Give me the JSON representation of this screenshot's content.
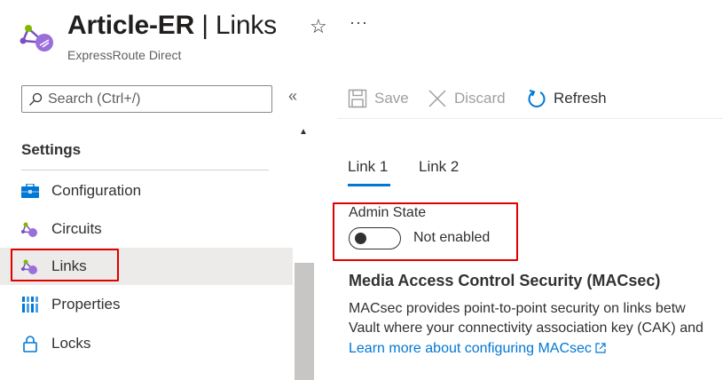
{
  "header": {
    "resource_name": "Article-ER",
    "separator": "|",
    "blade_name": "Links",
    "subtitle": "ExpressRoute Direct",
    "star_icon": "☆",
    "more_icon": "···"
  },
  "search": {
    "placeholder": "Search (Ctrl+/)",
    "value": ""
  },
  "sidebar": {
    "collapse_icon": "«",
    "section_heading": "Settings",
    "items": [
      {
        "label": "Configuration",
        "icon": "toolbox-icon"
      },
      {
        "label": "Circuits",
        "icon": "expressroute-icon"
      },
      {
        "label": "Links",
        "icon": "expressroute-icon",
        "selected": true
      },
      {
        "label": "Properties",
        "icon": "properties-icon"
      },
      {
        "label": "Locks",
        "icon": "lock-icon"
      }
    ]
  },
  "toolbar": {
    "save_label": "Save",
    "discard_label": "Discard",
    "refresh_label": "Refresh"
  },
  "tabs": [
    {
      "label": "Link 1",
      "active": true
    },
    {
      "label": "Link 2",
      "active": false
    }
  ],
  "admin_state": {
    "label": "Admin State",
    "toggle_text": "Not enabled",
    "enabled": false
  },
  "macsec": {
    "heading": "Media Access Control Security (MACsec)",
    "line1": "MACsec provides point-to-point security on links betw",
    "line2": "Vault where your connectivity association key (CAK) and",
    "link_text": "Learn more about configuring MACsec"
  },
  "colors": {
    "accent": "#0078d4",
    "highlight": "#e00000",
    "selected_bg": "#edebe9"
  }
}
